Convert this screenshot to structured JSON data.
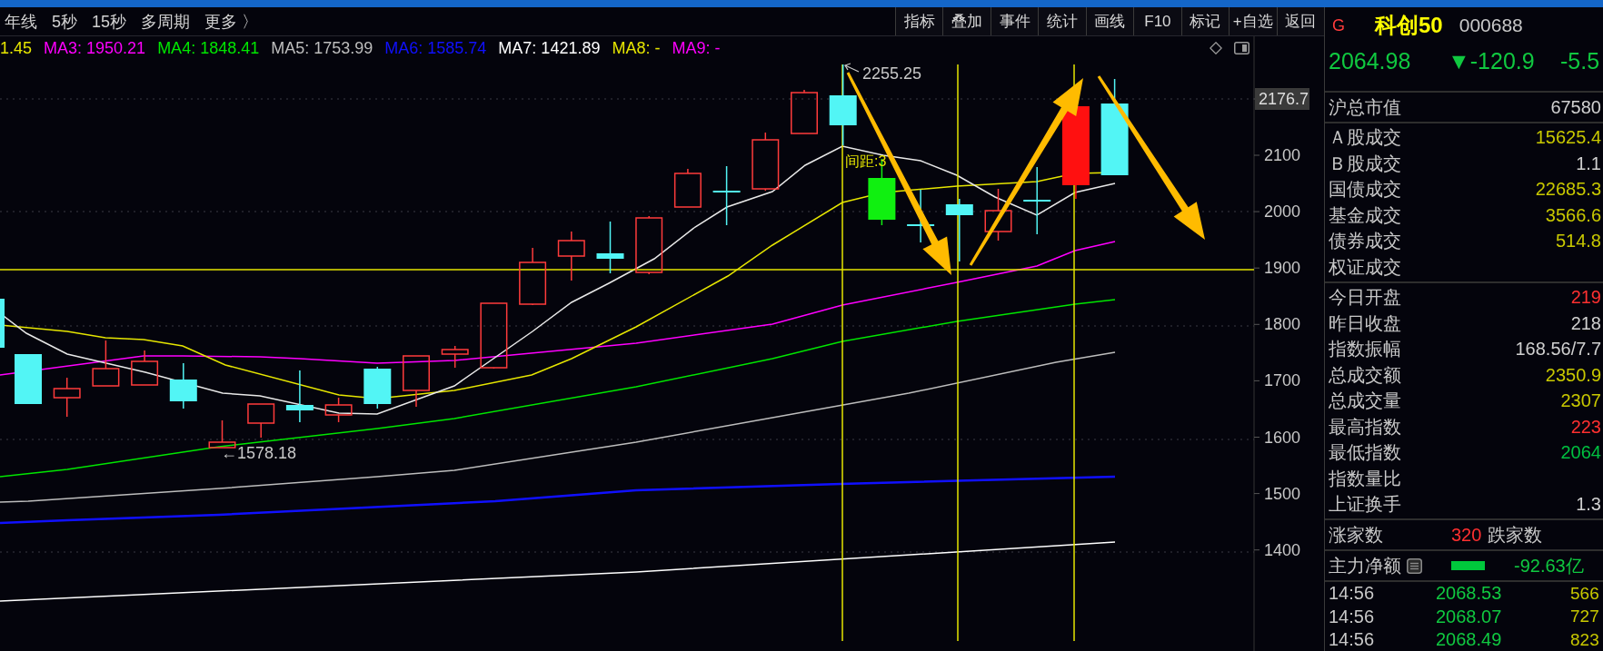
{
  "period_tabs": [
    "年线",
    "5秒",
    "15秒",
    "多周期",
    "更多 〉"
  ],
  "toolbar": [
    "指标",
    "叠加",
    "事件",
    "统计",
    "画线",
    "F10",
    "标记",
    "+自选",
    "返回"
  ],
  "ma_legend": [
    {
      "text": "1.45",
      "color": "#e6e600"
    },
    {
      "text": "MA3: 1950.21",
      "color": "#ff00ff"
    },
    {
      "text": "MA4: 1848.41",
      "color": "#00e600"
    },
    {
      "text": "MA5: 1753.99",
      "color": "#bdbdbd"
    },
    {
      "text": "MA6: 1585.74",
      "color": "#1010ff"
    },
    {
      "text": "MA7: 1421.89",
      "color": "#ffffff"
    },
    {
      "text": "MA8: -",
      "color": "#e6e600"
    },
    {
      "text": "MA9: -",
      "color": "#ff00ff"
    }
  ],
  "chart": {
    "price_axis": [
      {
        "text": "2176.7",
        "kind": "current"
      },
      {
        "text": "2100",
        "kind": "tick"
      },
      {
        "text": "2000",
        "kind": "tick"
      },
      {
        "text": "1900",
        "kind": "tick"
      },
      {
        "text": "1800",
        "kind": "tick"
      },
      {
        "text": "1700",
        "kind": "tick"
      },
      {
        "text": "1600",
        "kind": "tick"
      },
      {
        "text": "1500",
        "kind": "tick"
      },
      {
        "text": "1400",
        "kind": "tick"
      }
    ],
    "high_label": "2255.25",
    "low_label": "←1578.18",
    "spacing_label": "间距:3"
  },
  "quote": {
    "badge": "G",
    "name": "科创50",
    "code": "000688",
    "price": "2064.98",
    "change": "▼-120.9",
    "change_percent": "-5.5",
    "falling": true
  },
  "stat_groups": [
    [
      {
        "label": "沪总市值",
        "value": "67580",
        "color": "#d0d0d0"
      }
    ],
    [
      {
        "label": "Ａ股成交",
        "value": "15625.4",
        "color": "#c8c800"
      },
      {
        "label": "Ｂ股成交",
        "value": "1.1",
        "color": "#d0d0d0"
      },
      {
        "label": "国债成交",
        "value": "22685.3",
        "color": "#c8c800"
      },
      {
        "label": "基金成交",
        "value": "3566.6",
        "color": "#c8c800"
      },
      {
        "label": "债券成交",
        "value": "514.8",
        "color": "#c8c800"
      },
      {
        "label": "权证成交"
      }
    ],
    [
      {
        "label": "今日开盘",
        "value": "219",
        "color": "#ff3030"
      },
      {
        "label": "昨日收盘",
        "value": "218",
        "color": "#d0d0d0"
      },
      {
        "label": "指数振幅",
        "value": "168.56/7.7",
        "color": "#d0d0d0"
      },
      {
        "label": "总成交额",
        "value": "2350.9",
        "color": "#c8c800"
      },
      {
        "label": "总成交量",
        "value": "2307",
        "color": "#c8c800"
      },
      {
        "label": "最高指数",
        "value": "223",
        "color": "#ff3030"
      },
      {
        "label": "最低指数",
        "value": "2064",
        "color": "#00c040"
      },
      {
        "label": "指数量比"
      },
      {
        "label": "上证换手",
        "value": "1.3",
        "color": "#d0d0d0"
      }
    ]
  ],
  "breadth": {
    "rise_label": "涨家数",
    "rise_count": "320",
    "fall_label": "跌家数"
  },
  "main_fund": {
    "label": "主力净额",
    "value": "-92.63亿"
  },
  "ticks": [
    {
      "time": "14:56",
      "price": "2068.53",
      "volume": "566"
    },
    {
      "time": "14:56",
      "price": "2068.07",
      "volume": "727"
    },
    {
      "time": "14:56",
      "price": "2068.49",
      "volume": "823"
    }
  ]
}
